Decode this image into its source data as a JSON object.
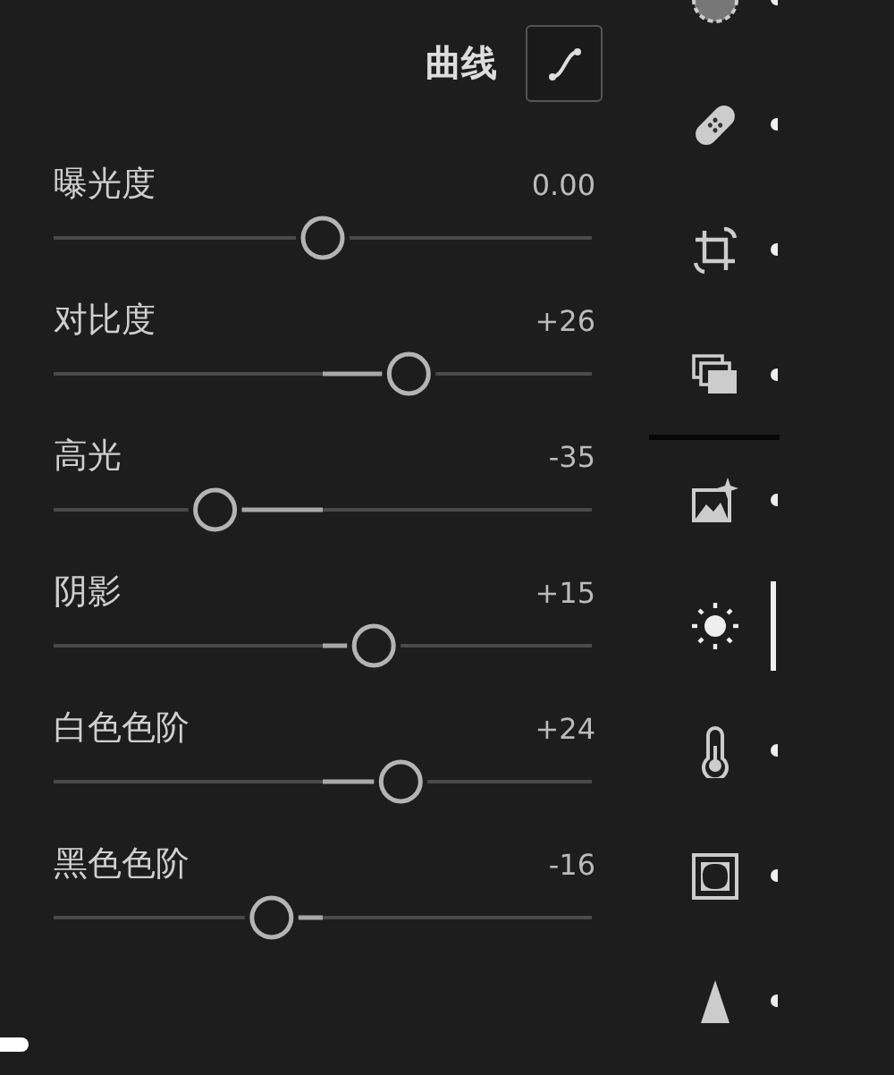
{
  "header": {
    "label": "曲线"
  },
  "sliders": [
    {
      "label": "曝光度",
      "value": "0.00",
      "level": 0.5
    },
    {
      "label": "对比度",
      "value": "+26",
      "level": 0.66
    },
    {
      "label": "高光",
      "value": "-35",
      "level": 0.3
    },
    {
      "label": "阴影",
      "value": "+15",
      "level": 0.595
    },
    {
      "label": "白色色阶",
      "value": "+24",
      "level": 0.645
    },
    {
      "label": "黑色色阶",
      "value": "-16",
      "level": 0.405
    }
  ],
  "rail": [
    {
      "kind": "mask",
      "selected": false
    },
    {
      "kind": "heal",
      "selected": false
    },
    {
      "kind": "crop",
      "selected": false
    },
    {
      "kind": "layers",
      "selected": false
    },
    {
      "kind": "divider"
    },
    {
      "kind": "auto",
      "selected": false
    },
    {
      "kind": "light",
      "selected": true
    },
    {
      "kind": "color",
      "selected": false
    },
    {
      "kind": "effects",
      "selected": false
    },
    {
      "kind": "detail",
      "selected": false
    }
  ]
}
